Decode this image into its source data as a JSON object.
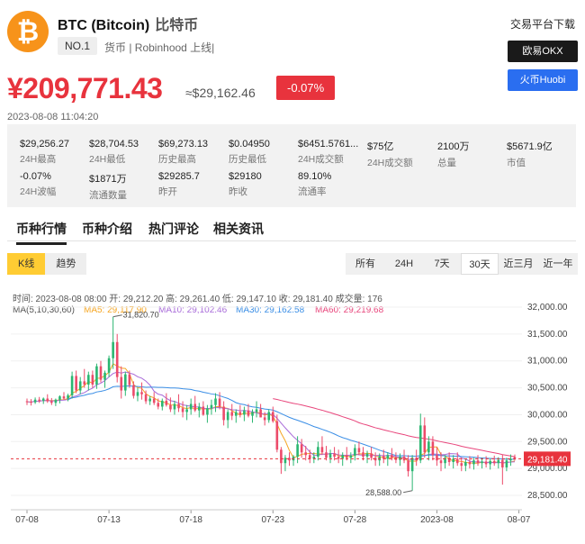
{
  "coin": {
    "logo_symbol": "₿",
    "name": "BTC (Bitcoin)",
    "name_cn": "比特币",
    "rank": "NO.1",
    "meta": "货币 | Robinhood 上线|"
  },
  "exchange_panel": {
    "title": "交易平台下载",
    "buttons": [
      "欧易OKX",
      "火币Huobi"
    ]
  },
  "price": {
    "cny": "¥209,771.43",
    "usd": "≈$29,162.46",
    "change": "-0.07%",
    "timestamp": "2023-08-08 11:04:20"
  },
  "stats": [
    {
      "value": "$29,256.27",
      "label": "24H最高"
    },
    {
      "value": "$28,704.53",
      "label": "24H最低"
    },
    {
      "value": "$69,273.13",
      "label": "历史最高"
    },
    {
      "value": "$0.04950",
      "label": "历史最低"
    },
    {
      "value": "$6451.5761...",
      "label": "24H成交额"
    },
    {
      "value": "$75亿",
      "label": "24H成交额"
    },
    {
      "value": "2100万",
      "label": "总量"
    },
    {
      "value": "$5671.9亿",
      "label": "市值"
    },
    {
      "value": "-0.07%",
      "label": "24H波幅"
    },
    {
      "value": "$1871万",
      "label": "流通数量"
    },
    {
      "value": "$29285.7",
      "label": "昨开"
    },
    {
      "value": "$29180",
      "label": "昨收"
    },
    {
      "value": "89.10%",
      "label": "流通率"
    }
  ],
  "tabs": [
    "币种行情",
    "币种介绍",
    "热门评论",
    "相关资讯"
  ],
  "view_toggle": [
    "K线",
    "趋势"
  ],
  "periods": [
    "所有",
    "24H",
    "7天",
    "30天",
    "近三月",
    "近一年"
  ],
  "chart_info": {
    "line1": "时间: 2023-08-08 08:00   开: 29,212.20   高: 29,261.40   低: 29,147.10   收: 29,181.40   成交量: 176",
    "ma_title": "MA(5,10,30,60)",
    "ma5": "MA5: 29,117.90",
    "ma10": "MA10: 29,102.46",
    "ma30": "MA30: 29,162.58",
    "ma60": "MA60: 29,219.68",
    "high_marker": "31,820.70",
    "low_marker": "28,588.00",
    "last_price": "29,181.40"
  },
  "colors": {
    "up": "#2bb671",
    "down": "#ec4b6a",
    "ma5": "#f5a623",
    "ma10": "#a86bd9",
    "ma30": "#3a8ee6",
    "ma60": "#e8467c",
    "accent_red": "#e8333d"
  },
  "chart_data": {
    "type": "candlestick",
    "y_ticks": [
      "32,000.00",
      "31,500.00",
      "31,000.00",
      "30,500.00",
      "30,000.00",
      "29,500.00",
      "29,000.00",
      "28,500.00"
    ],
    "y_values": [
      32000,
      31500,
      31000,
      30500,
      30000,
      29500,
      29000,
      28500
    ],
    "ylim": [
      28300,
      32150
    ],
    "x_labels": [
      "07-08",
      "07-13",
      "07-18",
      "07-23",
      "07-28",
      "2023-08",
      "08-07"
    ],
    "x_label_index": [
      0,
      20,
      40,
      60,
      80,
      100,
      120
    ],
    "candles": [
      [
        30250,
        30300,
        30180,
        30240
      ],
      [
        30240,
        30290,
        30170,
        30230
      ],
      [
        30230,
        30320,
        30200,
        30280
      ],
      [
        30280,
        30330,
        30220,
        30260
      ],
      [
        30260,
        30320,
        30200,
        30300
      ],
      [
        30300,
        30380,
        30220,
        30250
      ],
      [
        30250,
        30310,
        30180,
        30220
      ],
      [
        30220,
        30300,
        30160,
        30280
      ],
      [
        30280,
        30360,
        30210,
        30340
      ],
      [
        30340,
        30420,
        30280,
        30300
      ],
      [
        30300,
        30390,
        30250,
        30360
      ],
      [
        30360,
        30800,
        30300,
        30720
      ],
      [
        30720,
        30820,
        30400,
        30450
      ],
      [
        30450,
        30700,
        30380,
        30620
      ],
      [
        30620,
        30850,
        30500,
        30560
      ],
      [
        30560,
        30800,
        30450,
        30740
      ],
      [
        30740,
        30820,
        30500,
        30560
      ],
      [
        30560,
        30950,
        30480,
        30900
      ],
      [
        30900,
        31000,
        30600,
        30650
      ],
      [
        30650,
        30820,
        30500,
        30780
      ],
      [
        30780,
        31100,
        30700,
        31050
      ],
      [
        31050,
        31820,
        30850,
        31350
      ],
      [
        31350,
        31500,
        30600,
        30700
      ],
      [
        30700,
        30900,
        30300,
        30450
      ],
      [
        30450,
        30800,
        30350,
        30750
      ],
      [
        30750,
        30820,
        30500,
        30550
      ],
      [
        30550,
        30620,
        30300,
        30350
      ],
      [
        30350,
        30500,
        30250,
        30420
      ],
      [
        30420,
        30600,
        30280,
        30380
      ],
      [
        30380,
        30450,
        30200,
        30250
      ],
      [
        30250,
        30350,
        30180,
        30300
      ],
      [
        30300,
        30420,
        30180,
        30220
      ],
      [
        30220,
        30300,
        30100,
        30150
      ],
      [
        30150,
        30300,
        30080,
        30260
      ],
      [
        30260,
        30400,
        30150,
        30180
      ],
      [
        30180,
        30320,
        30050,
        30100
      ],
      [
        30100,
        30260,
        30000,
        30200
      ],
      [
        30200,
        30380,
        30050,
        30120
      ],
      [
        30120,
        30250,
        29950,
        30050
      ],
      [
        30050,
        30180,
        29900,
        30100
      ],
      [
        30100,
        30300,
        30000,
        30200
      ],
      [
        30200,
        30350,
        30050,
        30080
      ],
      [
        30080,
        30220,
        29950,
        30150
      ],
      [
        30150,
        30250,
        29980,
        30000
      ],
      [
        30000,
        30180,
        29850,
        30120
      ],
      [
        30120,
        30280,
        30000,
        30180
      ],
      [
        30180,
        30400,
        30050,
        30300
      ],
      [
        30300,
        30420,
        30100,
        30150
      ],
      [
        30150,
        30250,
        29800,
        29900
      ],
      [
        29900,
        30100,
        29750,
        30050
      ],
      [
        30050,
        30200,
        29900,
        29980
      ],
      [
        29980,
        30100,
        29850,
        30050
      ],
      [
        30050,
        30180,
        29950,
        30000
      ],
      [
        30000,
        30150,
        29880,
        30080
      ],
      [
        30080,
        30200,
        29950,
        29980
      ],
      [
        29980,
        30100,
        29850,
        30050
      ],
      [
        30050,
        30250,
        29950,
        30100
      ],
      [
        30100,
        30200,
        29950,
        29950
      ],
      [
        29950,
        30050,
        29800,
        29900
      ],
      [
        29900,
        30100,
        29850,
        30050
      ],
      [
        30050,
        30150,
        29850,
        29880
      ],
      [
        29880,
        30000,
        29300,
        29350
      ],
      [
        29350,
        29400,
        28900,
        29100
      ],
      [
        29100,
        29250,
        28950,
        29200
      ],
      [
        29200,
        29300,
        29050,
        29150
      ],
      [
        29150,
        29250,
        29050,
        29220
      ],
      [
        29220,
        29600,
        29100,
        29450
      ],
      [
        29450,
        29550,
        29200,
        29300
      ],
      [
        29300,
        29420,
        29150,
        29250
      ],
      [
        29250,
        29350,
        29100,
        29180
      ],
      [
        29180,
        29300,
        29100,
        29220
      ],
      [
        29220,
        29500,
        29150,
        29400
      ],
      [
        29400,
        29600,
        29250,
        29300
      ],
      [
        29300,
        29420,
        29150,
        29200
      ],
      [
        29200,
        29350,
        29100,
        29280
      ],
      [
        29280,
        29400,
        29150,
        29220
      ],
      [
        29220,
        29350,
        29100,
        29180
      ],
      [
        29180,
        29300,
        29050,
        29250
      ],
      [
        29250,
        29400,
        29150,
        29200
      ],
      [
        29200,
        29300,
        29100,
        29240
      ],
      [
        29240,
        29450,
        29150,
        29380
      ],
      [
        29380,
        29500,
        29250,
        29300
      ],
      [
        29300,
        29400,
        29150,
        29220
      ],
      [
        29220,
        29330,
        29100,
        29280
      ],
      [
        29280,
        29400,
        29150,
        29200
      ],
      [
        29200,
        29300,
        29050,
        29150
      ],
      [
        29150,
        29280,
        29050,
        29230
      ],
      [
        29230,
        29350,
        29100,
        29180
      ],
      [
        29180,
        29300,
        29050,
        29250
      ],
      [
        29250,
        29380,
        29150,
        29200
      ],
      [
        29200,
        29300,
        29100,
        29160
      ],
      [
        29160,
        29280,
        29050,
        29220
      ],
      [
        29220,
        29350,
        29100,
        29150
      ],
      [
        29150,
        29250,
        28850,
        28950
      ],
      [
        28950,
        29250,
        28588,
        29200
      ],
      [
        29200,
        29350,
        29050,
        29150
      ],
      [
        29150,
        30020,
        29100,
        29800
      ],
      [
        29800,
        29950,
        29200,
        29300
      ],
      [
        29300,
        29600,
        29150,
        29500
      ],
      [
        29500,
        29600,
        29150,
        29250
      ],
      [
        29250,
        29400,
        29050,
        29150
      ],
      [
        29150,
        29300,
        28950,
        29100
      ],
      [
        29100,
        29250,
        29000,
        29200
      ],
      [
        29200,
        29300,
        29050,
        29120
      ],
      [
        29120,
        29250,
        29000,
        29180
      ],
      [
        29180,
        29300,
        29050,
        29100
      ],
      [
        29100,
        29200,
        28950,
        29050
      ],
      [
        29050,
        29180,
        28950,
        29120
      ],
      [
        29120,
        29230,
        29000,
        29080
      ],
      [
        29080,
        29200,
        28980,
        29150
      ],
      [
        29150,
        29250,
        29050,
        29100
      ],
      [
        29100,
        29200,
        29000,
        29130
      ],
      [
        29130,
        29230,
        29020,
        29080
      ],
      [
        29080,
        29180,
        28980,
        29140
      ],
      [
        29140,
        29240,
        29050,
        29100
      ],
      [
        29100,
        29210,
        29000,
        29160
      ],
      [
        29160,
        29260,
        28700,
        29020
      ],
      [
        29020,
        29200,
        28950,
        29150
      ],
      [
        29150,
        29261,
        29050,
        29180
      ],
      [
        29212,
        29261,
        29147,
        29181
      ]
    ]
  }
}
